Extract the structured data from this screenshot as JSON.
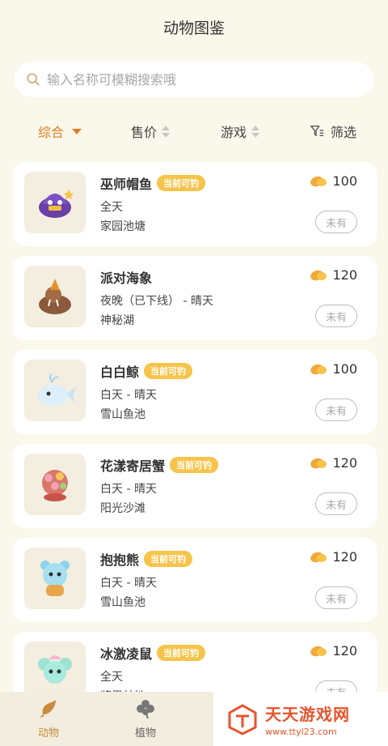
{
  "header": {
    "title": "动物图鉴"
  },
  "search": {
    "placeholder": "输入名称可模糊搜索哦"
  },
  "filters": {
    "comprehensive": "综合",
    "price": "售价",
    "game": "游戏",
    "filter": "筛选"
  },
  "items": [
    {
      "name": "巫师帽鱼",
      "badge": "当前可钓",
      "time": "全天",
      "location": "家园池塘",
      "price": "100",
      "status": "未有"
    },
    {
      "name": "派对海象",
      "badge": "",
      "time": "夜晚（已下线） - 晴天",
      "location": "神秘湖",
      "price": "120",
      "status": "未有"
    },
    {
      "name": "白白鲸",
      "badge": "当前可钓",
      "time": "白天 - 晴天",
      "location": "雪山鱼池",
      "price": "100",
      "status": "未有"
    },
    {
      "name": "花漾寄居蟹",
      "badge": "当前可钓",
      "time": "白天 - 晴天",
      "location": "阳光沙滩",
      "price": "120",
      "status": "未有"
    },
    {
      "name": "抱抱熊",
      "badge": "当前可钓",
      "time": "白天 - 晴天",
      "location": "雪山鱼池",
      "price": "120",
      "status": "未有"
    },
    {
      "name": "冰激凌鼠",
      "badge": "当前可钓",
      "time": "全天",
      "location": "浆果林地",
      "price": "120",
      "status": "未有"
    }
  ],
  "tabs": {
    "animals": "动物",
    "plants": "植物"
  },
  "watermark": {
    "title": "天天游戏网",
    "url": "www.ttyl23.com"
  },
  "colors": {
    "accent": "#E07F22",
    "badge": "#F6C44B",
    "background": "#FAF7EB",
    "watermark": "#E8542E"
  }
}
